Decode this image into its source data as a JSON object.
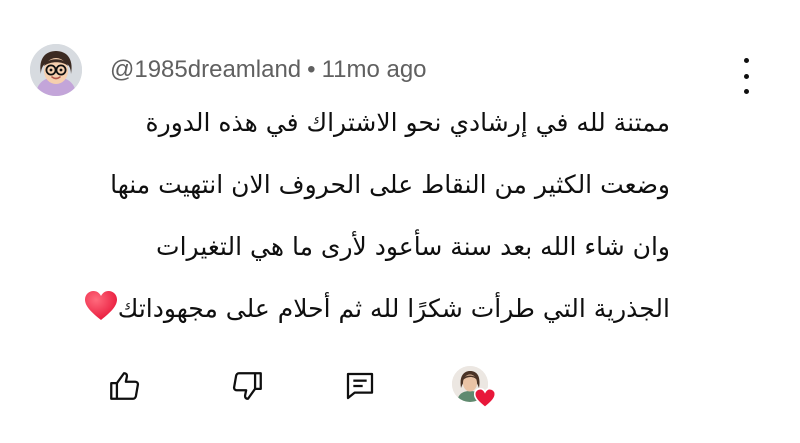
{
  "comment": {
    "author": "@1985dreamland",
    "separator": "•",
    "time": "11mo ago",
    "lines": [
      "ممتنة لله في إرشادي نحو الاشتراك في هذه الدورة",
      "وضعت الكثير من النقاط على الحروف الان انتهيت منها",
      "وان شاء الله بعد سنة سأعود لأرى ما هي التغيرات",
      "الجذرية التي طرأت شكرًا لله ثم أحلام على مجهوداتك"
    ],
    "trailing_emoji": "red-heart-emoji"
  },
  "icons": {
    "avatar": "cartoon-avatar-with-glasses",
    "menu": "more-vertical-icon",
    "like": "thumbs-up-icon",
    "dislike": "thumbs-down-icon",
    "reply": "reply-comment-icon",
    "creator_heart": "creator-heart-badge"
  },
  "colors": {
    "text": "#0f0f0f",
    "meta": "#606060",
    "heart": "#e8173a"
  }
}
